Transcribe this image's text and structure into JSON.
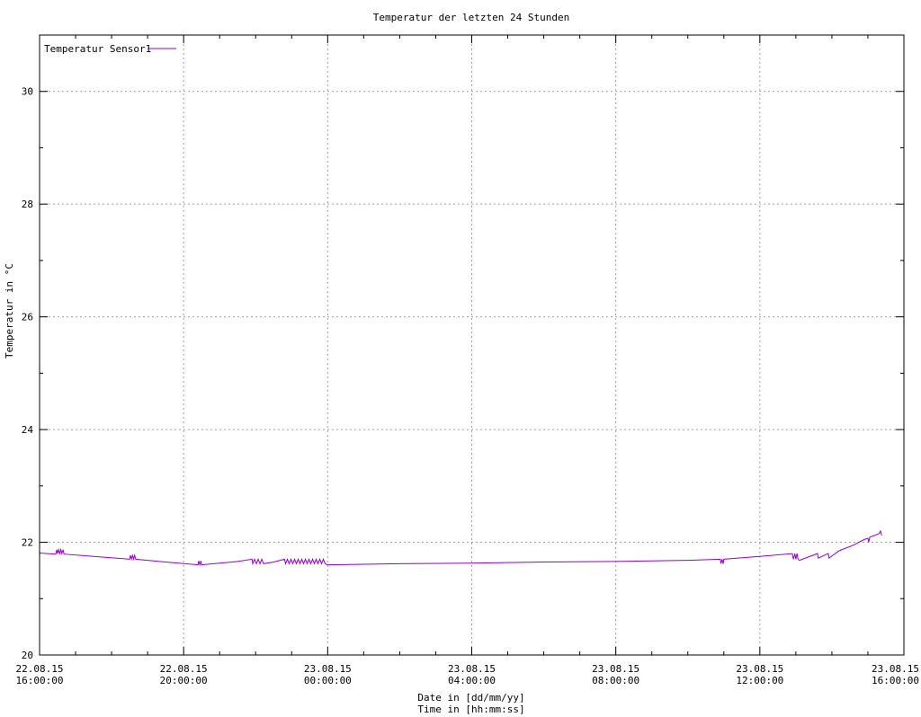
{
  "chart_data": {
    "type": "line",
    "title": "Temperatur der letzten 24 Stunden",
    "xlabel_lines": [
      "Date in [dd/mm/yy]",
      "Time in [hh:mm:ss]"
    ],
    "ylabel": "Temperatur in °C",
    "xlim": [
      0,
      24
    ],
    "ylim": [
      20,
      31
    ],
    "y_ticks": [
      20,
      22,
      24,
      26,
      28,
      30
    ],
    "x_ticks": [
      {
        "x": 0,
        "date": "22.08.15",
        "time": "16:00:00"
      },
      {
        "x": 4,
        "date": "22.08.15",
        "time": "20:00:00"
      },
      {
        "x": 8,
        "date": "23.08.15",
        "time": "00:00:00"
      },
      {
        "x": 12,
        "date": "23.08.15",
        "time": "04:00:00"
      },
      {
        "x": 16,
        "date": "23.08.15",
        "time": "08:00:00"
      },
      {
        "x": 20,
        "date": "23.08.15",
        "time": "12:00:00"
      },
      {
        "x": 24,
        "date": "23.08.15",
        "time": "16:00:00"
      }
    ],
    "grid": true,
    "legend_position": "top-left",
    "series": [
      {
        "name": "Temperatur Sensor1",
        "color": "#9400d3",
        "points": [
          [
            0,
            21.81
          ],
          [
            0.45,
            21.79
          ],
          [
            0.48,
            21.87
          ],
          [
            0.5,
            21.8
          ],
          [
            0.53,
            21.87
          ],
          [
            0.56,
            21.8
          ],
          [
            0.59,
            21.87
          ],
          [
            0.62,
            21.8
          ],
          [
            0.65,
            21.87
          ],
          [
            0.68,
            21.79
          ],
          [
            1.5,
            21.75
          ],
          [
            2.5,
            21.7
          ],
          [
            2.52,
            21.77
          ],
          [
            2.55,
            21.7
          ],
          [
            2.58,
            21.77
          ],
          [
            2.61,
            21.7
          ],
          [
            2.64,
            21.77
          ],
          [
            2.67,
            21.7
          ],
          [
            3.5,
            21.65
          ],
          [
            4.4,
            21.6
          ],
          [
            4.42,
            21.67
          ],
          [
            4.45,
            21.6
          ],
          [
            4.48,
            21.67
          ],
          [
            4.5,
            21.6
          ],
          [
            5.0,
            21.63
          ],
          [
            5.5,
            21.66
          ],
          [
            5.9,
            21.7
          ],
          [
            5.92,
            21.62
          ],
          [
            5.97,
            21.7
          ],
          [
            6.02,
            21.62
          ],
          [
            6.07,
            21.7
          ],
          [
            6.12,
            21.62
          ],
          [
            6.17,
            21.7
          ],
          [
            6.22,
            21.62
          ],
          [
            6.5,
            21.65
          ],
          [
            6.8,
            21.7
          ],
          [
            6.83,
            21.62
          ],
          [
            6.88,
            21.7
          ],
          [
            6.93,
            21.62
          ],
          [
            6.98,
            21.7
          ],
          [
            7.03,
            21.62
          ],
          [
            7.08,
            21.7
          ],
          [
            7.13,
            21.62
          ],
          [
            7.18,
            21.7
          ],
          [
            7.23,
            21.62
          ],
          [
            7.28,
            21.7
          ],
          [
            7.33,
            21.62
          ],
          [
            7.38,
            21.7
          ],
          [
            7.43,
            21.62
          ],
          [
            7.48,
            21.7
          ],
          [
            7.53,
            21.62
          ],
          [
            7.58,
            21.7
          ],
          [
            7.63,
            21.62
          ],
          [
            7.68,
            21.7
          ],
          [
            7.73,
            21.62
          ],
          [
            7.78,
            21.7
          ],
          [
            7.83,
            21.62
          ],
          [
            7.88,
            21.7
          ],
          [
            7.93,
            21.62
          ],
          [
            8.0,
            21.6
          ],
          [
            10.0,
            21.62
          ],
          [
            12.0,
            21.63
          ],
          [
            14.0,
            21.65
          ],
          [
            16.0,
            21.66
          ],
          [
            18.0,
            21.68
          ],
          [
            18.9,
            21.7
          ],
          [
            18.92,
            21.62
          ],
          [
            18.95,
            21.7
          ],
          [
            18.98,
            21.62
          ],
          [
            19.0,
            21.7
          ],
          [
            20.0,
            21.75
          ],
          [
            20.9,
            21.8
          ],
          [
            20.93,
            21.7
          ],
          [
            20.97,
            21.8
          ],
          [
            21.0,
            21.7
          ],
          [
            21.03,
            21.8
          ],
          [
            21.06,
            21.7
          ],
          [
            21.1,
            21.68
          ],
          [
            21.6,
            21.8
          ],
          [
            21.62,
            21.72
          ],
          [
            21.9,
            21.8
          ],
          [
            21.92,
            21.72
          ],
          [
            22.2,
            21.85
          ],
          [
            22.6,
            21.95
          ],
          [
            22.9,
            22.05
          ],
          [
            23.0,
            22.07
          ],
          [
            23.02,
            22.0
          ],
          [
            23.05,
            22.09
          ],
          [
            23.3,
            22.15
          ],
          [
            23.35,
            22.2
          ],
          [
            23.38,
            22.12
          ]
        ]
      }
    ]
  }
}
